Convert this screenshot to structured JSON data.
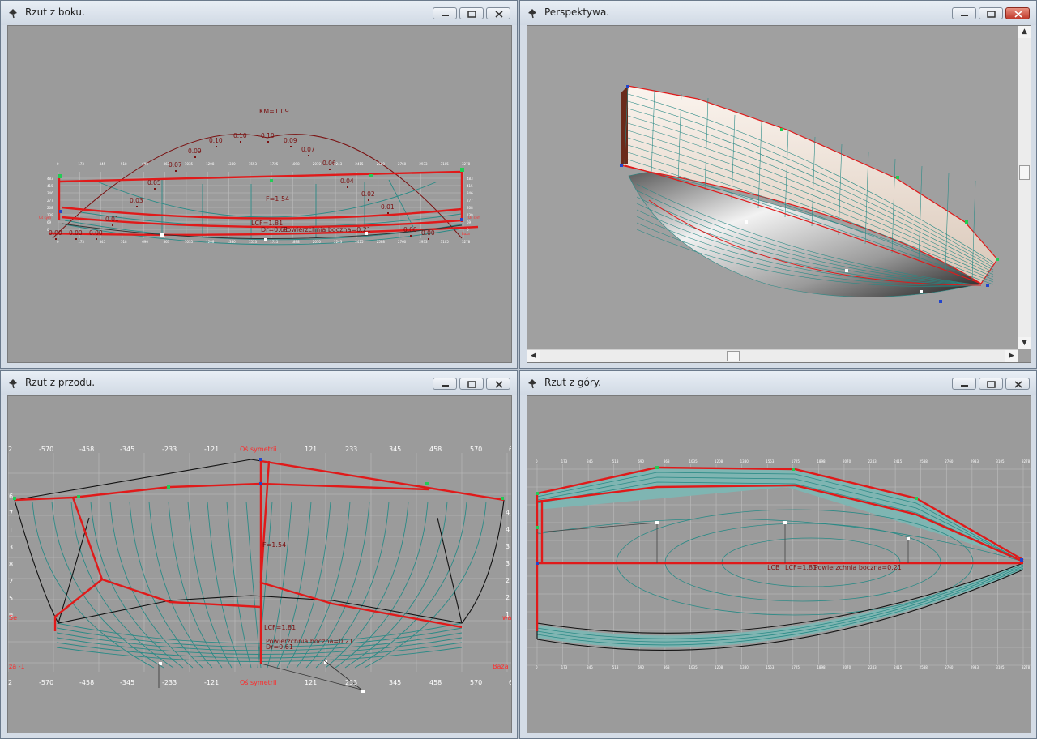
{
  "windows": {
    "side": {
      "title": "Rzut z boku."
    },
    "persp": {
      "title": "Perspektywa."
    },
    "front": {
      "title": "Rzut z przodu."
    },
    "top": {
      "title": "Rzut z góry."
    }
  },
  "side_view": {
    "km_label": "KM=1.09",
    "f_label": "F=1.54",
    "lcf_label": "LCF=1.81",
    "side_area_label": "Powierzchnia boczna=0.21",
    "dr_label": "Dr=0.61",
    "curve_labels": [
      "0.00",
      "0.00",
      "0.00",
      "0.01",
      "0.03",
      "0.05",
      "0.07",
      "0.09",
      "0.10",
      "0.10",
      "0.10",
      "0.09",
      "0.07",
      "0.06",
      "0.04",
      "0.02",
      "0.01",
      "0.00",
      "0.00"
    ],
    "top_ticks": [
      "0",
      "173",
      "345",
      "518",
      "690",
      "863",
      "1035",
      "1208",
      "1380",
      "1553",
      "1725",
      "1898",
      "2070",
      "2243",
      "2415",
      "2588",
      "2760",
      "2933",
      "3105",
      "3278"
    ],
    "left_ticks": [
      "483",
      "415",
      "346",
      "277",
      "208",
      "139",
      "69",
      "0"
    ],
    "left_red": "Oś sym",
    "right_red": "Oś sym",
    "baza_right": "Baza"
  },
  "front_view": {
    "top_ticks": [
      "2",
      "-570",
      "-458",
      "-345",
      "-233",
      "-121",
      "Oś symetrii",
      "121",
      "233",
      "345",
      "458",
      "570",
      "6"
    ],
    "bottom_ticks": [
      "2",
      "-570",
      "-458",
      "-345",
      "-233",
      "-121",
      "Oś symetrii",
      "121",
      "233",
      "345",
      "458",
      "570",
      "6"
    ],
    "left_ticks": [
      "6",
      "7",
      "1",
      "3",
      "8",
      "2",
      "5",
      "9"
    ],
    "right_ticks": [
      "4",
      "4",
      "3",
      "3",
      "2",
      "2",
      "1"
    ],
    "f_label": "F=1.54",
    "lcf_label": "LCF=1.81",
    "side_area_label": "Powierzchnia boczna=0.21",
    "dr_label": "Dr=0.61",
    "left_red_a": "Se",
    "left_red_b": "za -1",
    "right_red_a": "wa",
    "right_red_b": "Baza"
  },
  "top_view": {
    "top_ticks": [
      "0",
      "173",
      "345",
      "518",
      "690",
      "863",
      "1035",
      "1208",
      "1380",
      "1553",
      "1725",
      "1898",
      "2070",
      "2243",
      "2415",
      "2588",
      "2760",
      "2933",
      "3105",
      "3278"
    ],
    "bottom_ticks": [
      "0",
      "173",
      "345",
      "518",
      "690",
      "863",
      "1035",
      "1208",
      "1380",
      "1553",
      "1725",
      "1898",
      "2070",
      "2243",
      "2415",
      "2588",
      "2760",
      "2933",
      "3105",
      "3278"
    ],
    "lcb_label": "LCB",
    "lcf_label": "LCF=1.81",
    "side_area_label": "Powierzchnia boczna=0.21"
  },
  "colors": {
    "background": "#9b9b9b",
    "hull_red": "#e01a1a",
    "station_teal": "#2a8a86",
    "grid": "#c8c8c8",
    "label_dark_red": "#8a0f0f",
    "axis_red": "#ff2a2a"
  }
}
